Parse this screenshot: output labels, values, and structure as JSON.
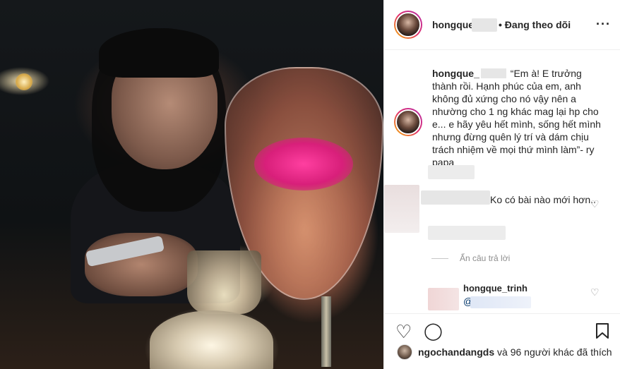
{
  "post": {
    "author": "hongque_",
    "follow_status": "• Đang theo dõi",
    "more_icon": "···",
    "caption_author": "hongque_",
    "caption_text": "“Em à! E trưởng thành rồi. Hạnh phúc của em, anh không đủ xứng cho nó vậy nên a nhường cho 1 ng khác mag lại hp cho e... e hãy yêu hết mình, sống hết mình nhưng đừng quên lý trí và dám chịu trách nhiệm về mọi thứ mình làm”- ry papa"
  },
  "comments": [
    {
      "text": "Ko có bài nào mới hơn..",
      "hide_replies": "Ẩn câu trả lời"
    }
  ],
  "reply": {
    "author": "hongque_trinh",
    "mention_prefix": "@"
  },
  "actions": {
    "like_icon": "♡",
    "comment_icon": "◯",
    "save_icon": "bookmark-icon"
  },
  "likes": {
    "user": "ngochandangds",
    "rest": "và 96 người khác đã thích"
  }
}
